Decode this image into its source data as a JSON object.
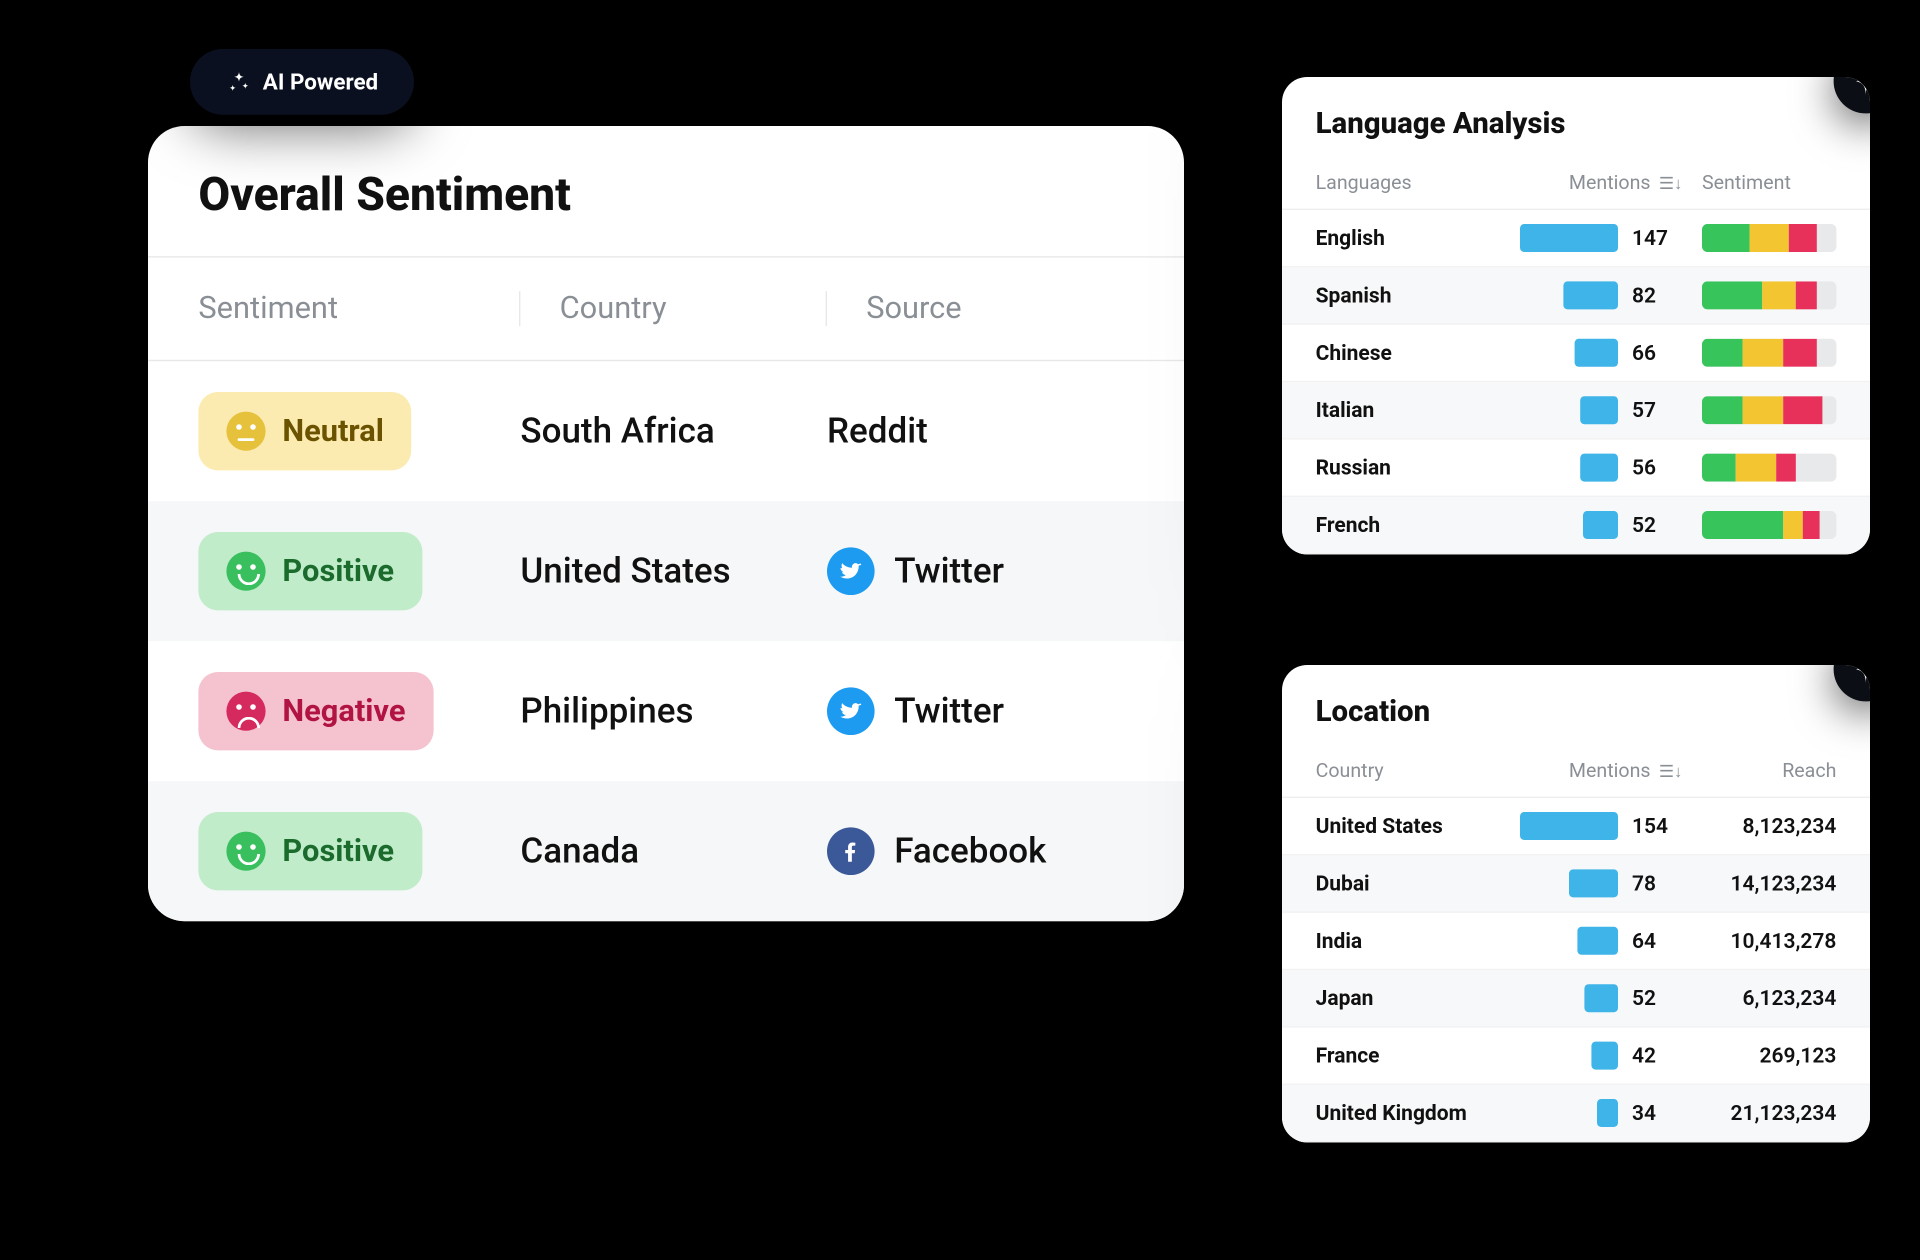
{
  "badge": {
    "label": "AI Powered"
  },
  "overall": {
    "title": "Overall Sentiment",
    "headers": {
      "sentiment": "Sentiment",
      "country": "Country",
      "source": "Source"
    },
    "rows": [
      {
        "sentiment": "Neutral",
        "sclass": "neutral",
        "country": "South Africa",
        "source": "Reddit",
        "sicon": "reddit"
      },
      {
        "sentiment": "Positive",
        "sclass": "positive",
        "country": "United States",
        "source": "Twitter",
        "sicon": "twitter"
      },
      {
        "sentiment": "Negative",
        "sclass": "negative",
        "country": "Philippines",
        "source": "Twitter",
        "sicon": "twitter"
      },
      {
        "sentiment": "Positive",
        "sclass": "positive",
        "country": "Canada",
        "source": "Facebook",
        "sicon": "facebook"
      }
    ]
  },
  "lang": {
    "title": "Language Analysis",
    "headers": {
      "languages": "Languages",
      "mentions": "Mentions",
      "sentiment": "Sentiment"
    },
    "max": 147,
    "rows": [
      {
        "name": "English",
        "mentions": 147,
        "g": 35,
        "y": 30,
        "r": 20
      },
      {
        "name": "Spanish",
        "mentions": 82,
        "g": 45,
        "y": 25,
        "r": 15
      },
      {
        "name": "Chinese",
        "mentions": 66,
        "g": 30,
        "y": 30,
        "r": 25
      },
      {
        "name": "Italian",
        "mentions": 57,
        "g": 30,
        "y": 30,
        "r": 30
      },
      {
        "name": "Russian",
        "mentions": 56,
        "g": 25,
        "y": 30,
        "r": 15
      },
      {
        "name": "French",
        "mentions": 52,
        "g": 60,
        "y": 15,
        "r": 12
      }
    ]
  },
  "loc": {
    "title": "Location",
    "headers": {
      "country": "Country",
      "mentions": "Mentions",
      "reach": "Reach"
    },
    "max": 154,
    "rows": [
      {
        "name": "United States",
        "mentions": 154,
        "reach": "8,123,234"
      },
      {
        "name": "Dubai",
        "mentions": 78,
        "reach": "14,123,234"
      },
      {
        "name": "India",
        "mentions": 64,
        "reach": "10,413,278"
      },
      {
        "name": "Japan",
        "mentions": 52,
        "reach": "6,123,234"
      },
      {
        "name": "France",
        "mentions": 42,
        "reach": "269,123"
      },
      {
        "name": "United Kingdom",
        "mentions": 34,
        "reach": "21,123,234"
      }
    ]
  },
  "chart_data": [
    {
      "type": "table",
      "title": "Overall Sentiment",
      "columns": [
        "Sentiment",
        "Country",
        "Source"
      ],
      "rows": [
        [
          "Neutral",
          "South Africa",
          "Reddit"
        ],
        [
          "Positive",
          "United States",
          "Twitter"
        ],
        [
          "Negative",
          "Philippines",
          "Twitter"
        ],
        [
          "Positive",
          "Canada",
          "Facebook"
        ]
      ]
    },
    {
      "type": "bar",
      "title": "Language Analysis — Mentions",
      "categories": [
        "English",
        "Spanish",
        "Chinese",
        "Italian",
        "Russian",
        "French"
      ],
      "values": [
        147,
        82,
        66,
        57,
        56,
        52
      ],
      "xlabel": "",
      "ylabel": "Mentions",
      "ylim": [
        0,
        150
      ]
    },
    {
      "type": "bar",
      "title": "Location — Mentions",
      "categories": [
        "United States",
        "Dubai",
        "India",
        "Japan",
        "France",
        "United Kingdom"
      ],
      "values": [
        154,
        78,
        64,
        52,
        42,
        34
      ],
      "xlabel": "",
      "ylabel": "Mentions",
      "ylim": [
        0,
        160
      ]
    },
    {
      "type": "table",
      "title": "Location — Reach",
      "columns": [
        "Country",
        "Reach"
      ],
      "rows": [
        [
          "United States",
          "8,123,234"
        ],
        [
          "Dubai",
          "14,123,234"
        ],
        [
          "India",
          "10,413,278"
        ],
        [
          "Japan",
          "6,123,234"
        ],
        [
          "France",
          "269,123"
        ],
        [
          "United Kingdom",
          "21,123,234"
        ]
      ]
    }
  ]
}
